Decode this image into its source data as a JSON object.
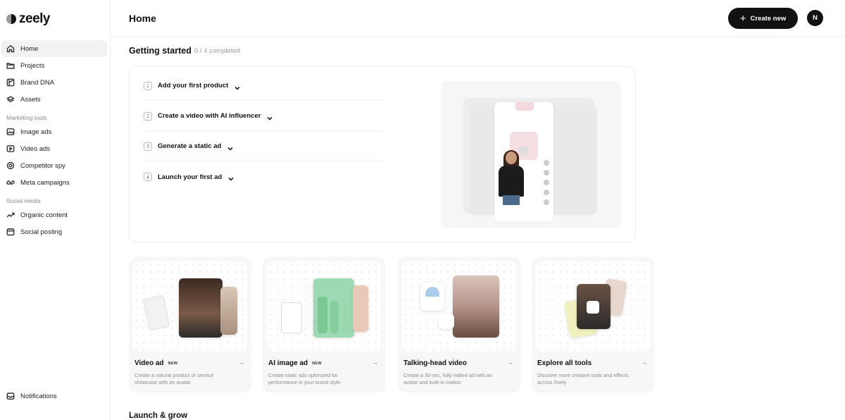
{
  "brand": {
    "name": "zeely"
  },
  "sidebar": {
    "main": [
      {
        "label": "Home",
        "icon": "home-icon"
      },
      {
        "label": "Projects",
        "icon": "folder-icon"
      },
      {
        "label": "Brand DNA",
        "icon": "brand-dna-icon"
      },
      {
        "label": "Assets",
        "icon": "layers-icon"
      }
    ],
    "marketing_title": "Marketing tools",
    "marketing": [
      {
        "label": "Image ads",
        "icon": "image-icon"
      },
      {
        "label": "Video ads",
        "icon": "video-icon"
      },
      {
        "label": "Competitor spy",
        "icon": "spy-icon"
      },
      {
        "label": "Meta campaigns",
        "icon": "meta-icon"
      }
    ],
    "social_title": "Social media",
    "social": [
      {
        "label": "Organic content",
        "icon": "trend-icon"
      },
      {
        "label": "Social posting",
        "icon": "calendar-icon"
      }
    ],
    "notifications": "Notifications"
  },
  "header": {
    "title": "Home",
    "create_label": "Create new",
    "avatar_initial": "N"
  },
  "getting_started": {
    "title": "Getting started",
    "progress": "0 / 4 completed",
    "steps": [
      {
        "num": "1",
        "label": "Add your first product"
      },
      {
        "num": "2",
        "label": "Create a video with AI influencer"
      },
      {
        "num": "3",
        "label": "Generate a static ad"
      },
      {
        "num": "4",
        "label": "Launch your first ad"
      }
    ]
  },
  "tools": [
    {
      "title": "Video ad",
      "badge": "NEW",
      "desc": "Create a natural product or service showcase with an avatar"
    },
    {
      "title": "AI image ad",
      "badge": "NEW",
      "desc": "Create static ads optimized for performance in your brand style"
    },
    {
      "title": "Talking-head video",
      "badge": "",
      "desc": "Create a 30-sec, fully edited ad with an avatar and built-in motion"
    },
    {
      "title": "Explore all tools",
      "badge": "",
      "desc": "Discover more creative tools and effects across Zeely"
    }
  ],
  "section2_title": "Launch & grow"
}
